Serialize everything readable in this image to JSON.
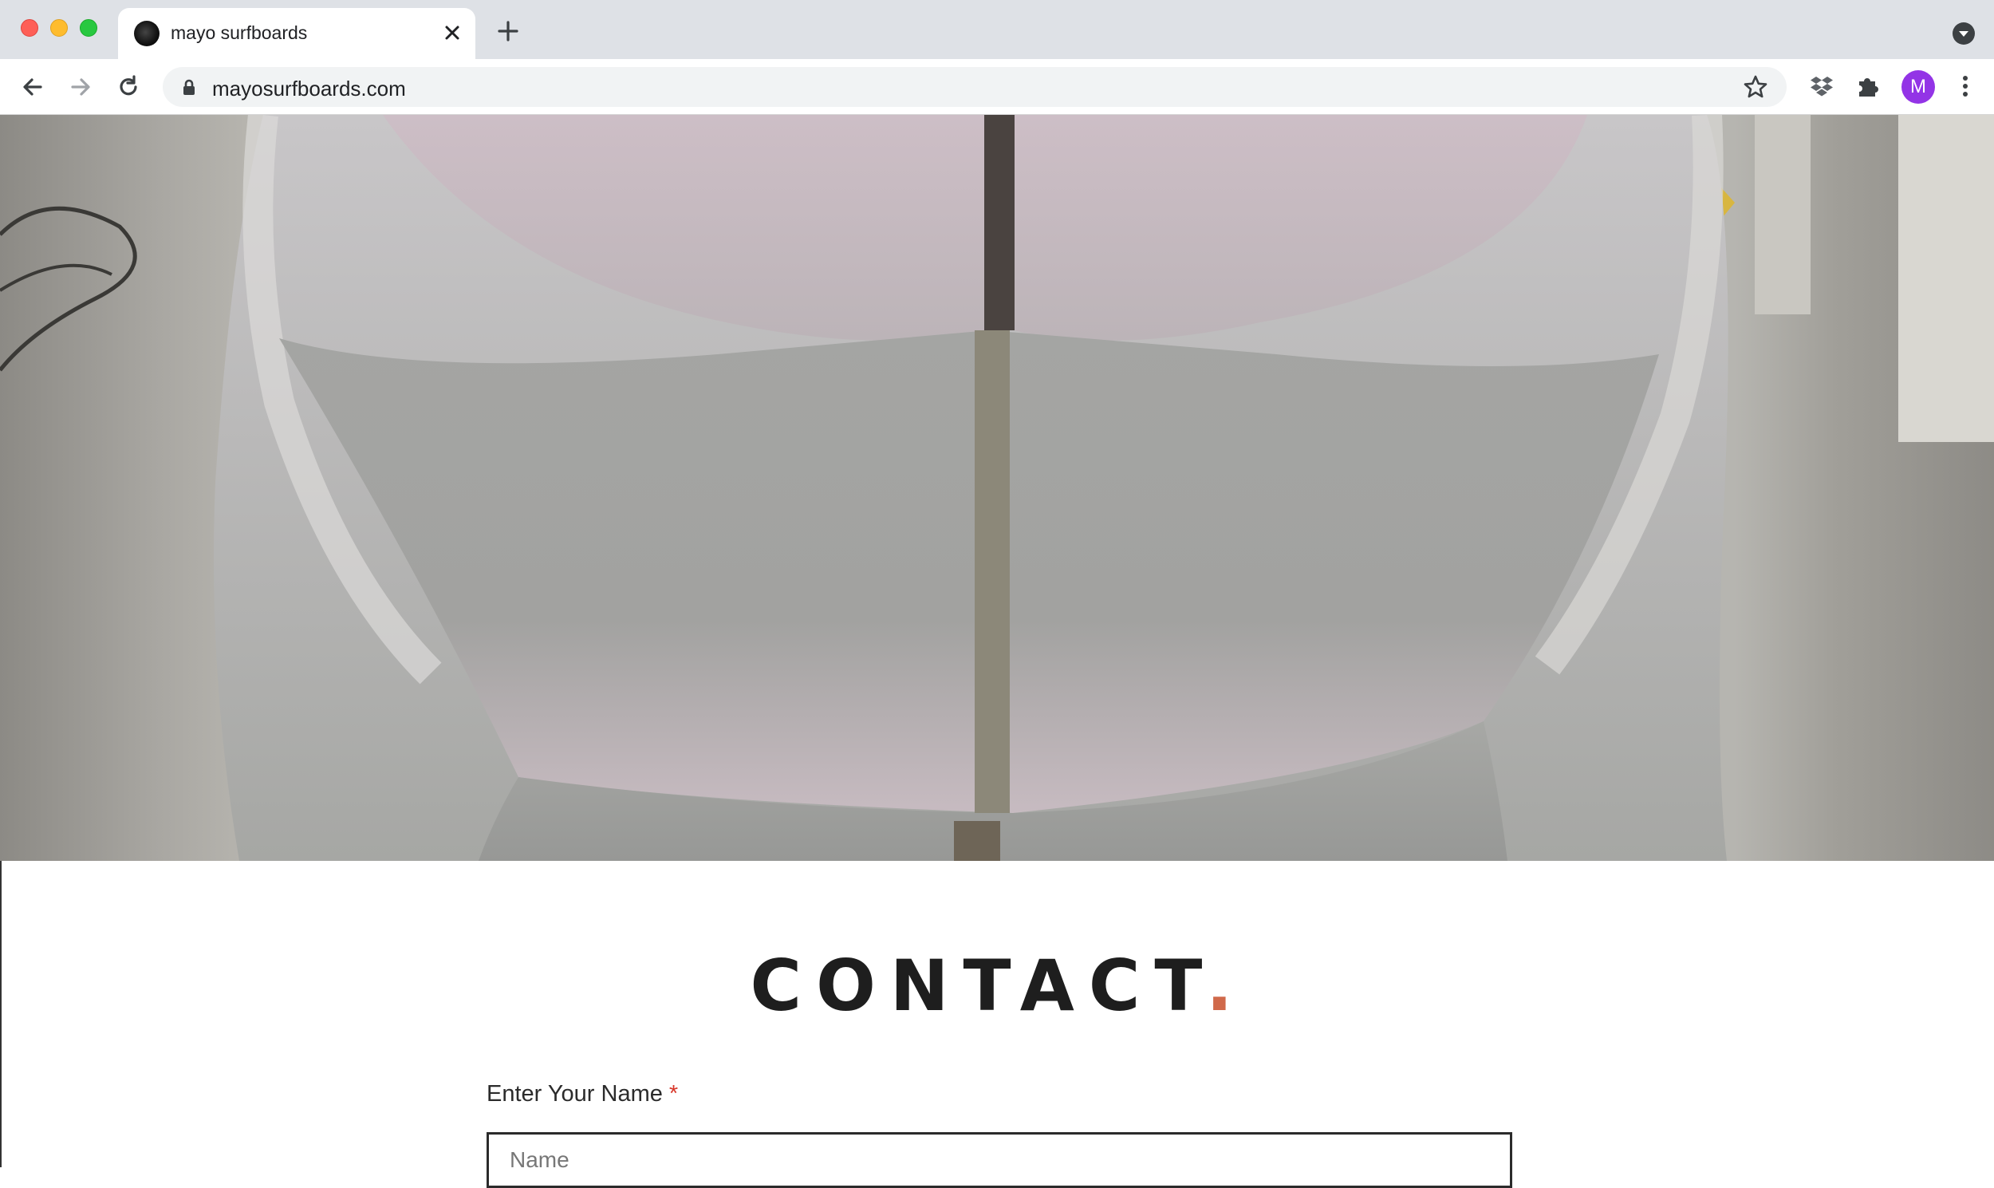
{
  "browser": {
    "tab": {
      "title": "mayo surfboards",
      "favicon": "mayo-logo-icon"
    },
    "url": "mayosurfboards.com",
    "profile_initial": "M",
    "icons": [
      "back-arrow-icon",
      "forward-arrow-icon",
      "reload-icon",
      "lock-icon",
      "bookmark-star-icon",
      "dropbox-icon",
      "extensions-puzzle-icon",
      "kebab-menu-icon",
      "close-icon",
      "plus-icon",
      "tab-search-icon"
    ],
    "colors": {
      "tabbar": "#dee1e6",
      "avatar": "#9334e6"
    }
  },
  "page": {
    "hero": {
      "image": "surfboard-tail-photo"
    },
    "contact": {
      "title": "CONTACT",
      "title_dot": ".",
      "name_label": "Enter Your Name",
      "required_mark": "*",
      "name_placeholder": "Name"
    },
    "colors": {
      "accent_dot": "#d0694a",
      "required": "#d8372a"
    }
  }
}
